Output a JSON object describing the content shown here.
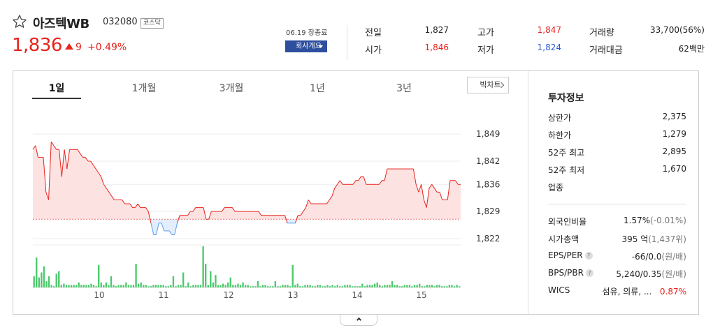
{
  "stock": {
    "name": "아즈텍WB",
    "code": "032080",
    "market": "코스닥",
    "price": "1,836",
    "change": "9",
    "change_pct": "+0.49%",
    "date": "06.19 장종료",
    "company_button": "회사개요"
  },
  "stats": [
    {
      "label": "전일",
      "value": "1,827",
      "tone": "neutral"
    },
    {
      "label": "시가",
      "value": "1,846",
      "tone": "up"
    },
    {
      "label": "고가",
      "value": "1,847",
      "tone": "up"
    },
    {
      "label": "저가",
      "value": "1,824",
      "tone": "down"
    },
    {
      "label": "거래량",
      "value": "33,700(56%)",
      "tone": "neutral"
    },
    {
      "label": "거래대금",
      "value": "62백만",
      "tone": "neutral"
    }
  ],
  "tabs": [
    "1일",
    "1개월",
    "3개월",
    "1년",
    "3년"
  ],
  "active_tab": "1일",
  "big_chart_button": "빅차트",
  "colors": {
    "up": "#e6231d",
    "down": "#2a5bd7",
    "volume": "#4cc96b",
    "area": "#fde2e2",
    "below": "#5b9cf0"
  },
  "info": {
    "title": "투자정보",
    "limits": [
      {
        "label": "상한가",
        "value": "2,375",
        "tone": "up"
      },
      {
        "label": "하한가",
        "value": "1,279",
        "tone": "down"
      },
      {
        "label": "52주 최고",
        "value": "2,895",
        "tone": "neutral"
      },
      {
        "label": "52주 최저",
        "value": "1,670",
        "tone": "neutral"
      },
      {
        "label": "업종",
        "value": "",
        "tone": "neutral"
      }
    ],
    "foreign_ratio": {
      "label": "외국인비율",
      "value": "1.57%",
      "sub": "(-0.01%)"
    },
    "market_cap": {
      "label": "시가총액",
      "value": "395",
      "unit": "억",
      "sub": "(1,437위)"
    },
    "eps_per": {
      "label": "EPS/PER",
      "value": "-66/0.0",
      "sub": "(원/배)"
    },
    "bps_pbr": {
      "label": "BPS/PBR",
      "value": "5,240/0.35",
      "sub": "(원/배)"
    },
    "wics": {
      "label": "WICS",
      "value": "섬유, 의류, ...",
      "change": "0.87%"
    }
  },
  "chart_data": {
    "type": "line",
    "title": "",
    "baseline": 1827,
    "ylim": [
      1822,
      1851
    ],
    "yticks": [
      "1,849",
      "1,842",
      "1,836",
      "1,829",
      "1,822"
    ],
    "xticks": [
      "10",
      "11",
      "12",
      "13",
      "14",
      "15"
    ],
    "price": [
      1845,
      1846,
      1843,
      1843,
      1843,
      1834,
      1832,
      1847,
      1846,
      1845,
      1845,
      1838,
      1845,
      1840,
      1845,
      1845,
      1845,
      1845,
      1844,
      1843,
      1843,
      1842,
      1842,
      1841,
      1840,
      1839,
      1838,
      1836,
      1835,
      1834,
      1833,
      1832,
      1832,
      1832,
      1832,
      1831,
      1831,
      1831,
      1830,
      1830,
      1831,
      1830,
      1830,
      1830,
      1829,
      1826,
      1823,
      1823,
      1826,
      1826,
      1824,
      1824,
      1824,
      1823,
      1823,
      1826,
      1828,
      1828,
      1828,
      1828,
      1829,
      1829,
      1830,
      1830,
      1830,
      1830,
      1827,
      1827,
      1829,
      1829,
      1829,
      1829,
      1829,
      1830,
      1830,
      1830,
      1830,
      1829,
      1829,
      1829,
      1829,
      1829,
      1829,
      1829,
      1829,
      1829,
      1829,
      1828,
      1828,
      1828,
      1828,
      1828,
      1828,
      1828,
      1828,
      1828,
      1828,
      1826,
      1826,
      1826,
      1826,
      1828,
      1828,
      1829,
      1830,
      1832,
      1831,
      1831,
      1831,
      1831,
      1831,
      1831,
      1831,
      1832,
      1833,
      1835,
      1836,
      1837,
      1836,
      1836,
      1836,
      1836,
      1836,
      1837,
      1837,
      1838,
      1838,
      1836,
      1836,
      1836,
      1836,
      1836,
      1836,
      1837,
      1837,
      1840,
      1840,
      1840,
      1840,
      1840,
      1840,
      1840,
      1840,
      1840,
      1840,
      1840,
      1836,
      1834,
      1836,
      1832,
      1830,
      1835,
      1836,
      1835,
      1834,
      1834,
      1832,
      1832,
      1832,
      1837,
      1837,
      1837,
      1836,
      1836
    ],
    "volume": [
      9,
      24,
      8,
      12,
      17,
      5,
      9,
      2,
      1,
      11,
      13,
      2,
      3,
      2,
      2,
      2,
      2,
      2,
      4,
      2,
      2,
      2,
      2,
      3,
      2,
      1,
      18,
      4,
      2,
      4,
      2,
      9,
      2,
      1,
      2,
      2,
      2,
      4,
      2,
      2,
      2,
      19,
      3,
      4,
      2,
      2,
      1,
      1,
      2,
      2,
      2,
      2,
      2,
      1,
      1,
      2,
      9,
      1,
      2,
      2,
      12,
      1,
      4,
      1,
      2,
      2,
      2,
      2,
      33,
      19,
      2,
      13,
      4,
      10,
      2,
      2,
      3,
      2,
      4,
      8,
      2,
      2,
      3,
      2,
      4,
      2,
      2,
      1,
      1,
      1,
      5,
      1,
      2,
      2,
      1,
      1,
      1,
      5,
      1,
      1,
      2,
      2,
      2,
      1,
      18,
      2,
      3,
      1,
      1,
      2,
      2,
      2,
      1,
      1,
      2,
      2,
      1,
      1,
      2,
      1,
      2,
      1,
      2,
      1,
      1,
      2,
      2,
      2,
      1,
      1,
      1,
      1,
      3,
      1,
      2,
      2,
      2,
      3,
      4,
      2,
      1,
      2,
      2,
      2,
      5,
      2,
      2,
      1,
      1,
      2,
      2,
      2,
      1,
      2,
      2,
      3,
      1,
      1,
      2,
      2,
      2,
      1,
      2,
      2,
      1,
      1,
      1,
      2,
      2,
      1,
      2,
      1
    ]
  }
}
